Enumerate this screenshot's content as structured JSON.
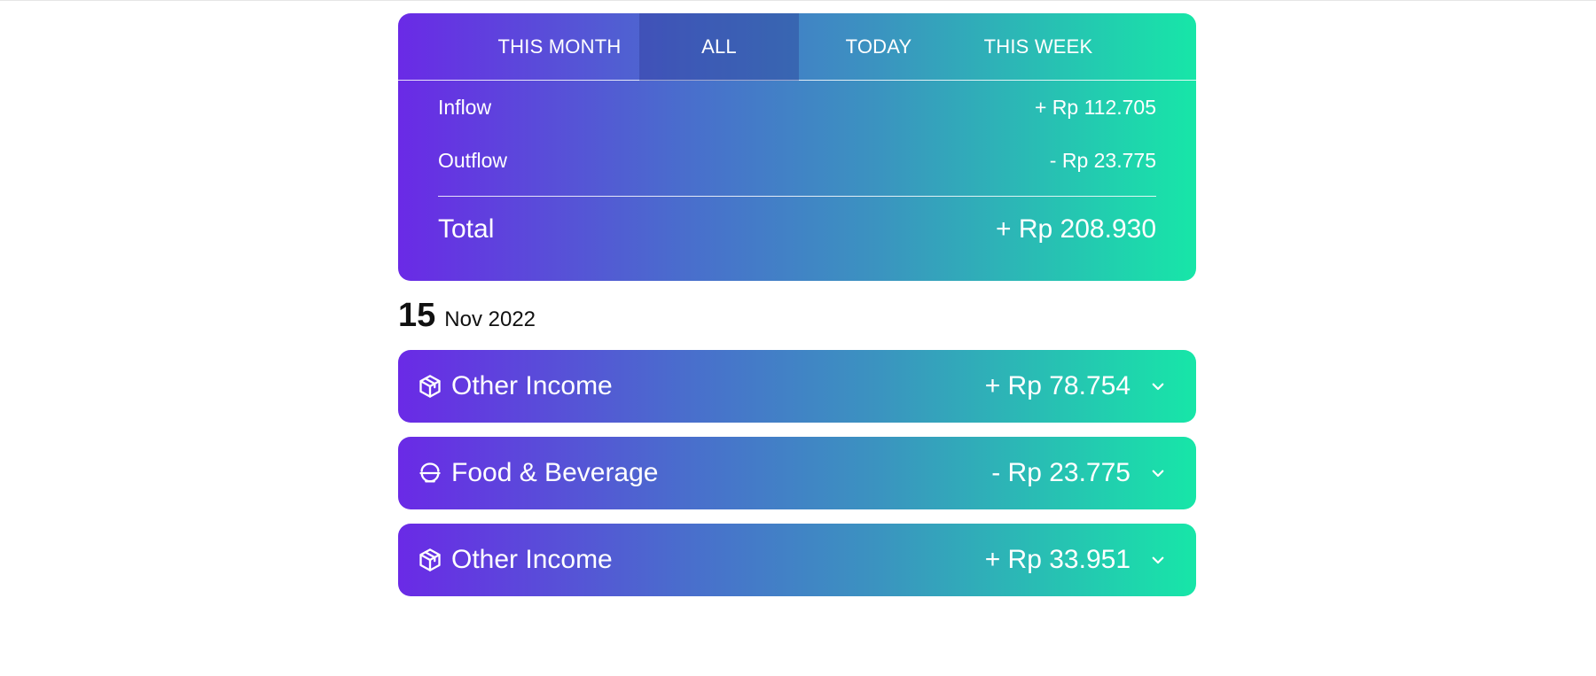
{
  "tabs": [
    {
      "label": "THIS MONTH",
      "active": false
    },
    {
      "label": "ALL",
      "active": true
    },
    {
      "label": "TODAY",
      "active": false
    },
    {
      "label": "THIS WEEK",
      "active": false
    }
  ],
  "summary": {
    "inflow_label": "Inflow",
    "inflow_value": "+ Rp 112.705",
    "outflow_label": "Outflow",
    "outflow_value": "- Rp 23.775",
    "total_label": "Total",
    "total_value": "+ Rp 208.930"
  },
  "date_group": {
    "day": "15",
    "month_year": "Nov 2022"
  },
  "transactions": [
    {
      "icon": "box-icon",
      "name": "Other Income",
      "amount": "+ Rp 78.754"
    },
    {
      "icon": "bowl-icon",
      "name": "Food & Beverage",
      "amount": "- Rp 23.775"
    },
    {
      "icon": "box-icon",
      "name": "Other Income",
      "amount": "+ Rp 33.951"
    }
  ],
  "colors": {
    "gradient_start": "#6a2ae6",
    "gradient_end": "#17e6a8",
    "text": "#ffffff"
  }
}
